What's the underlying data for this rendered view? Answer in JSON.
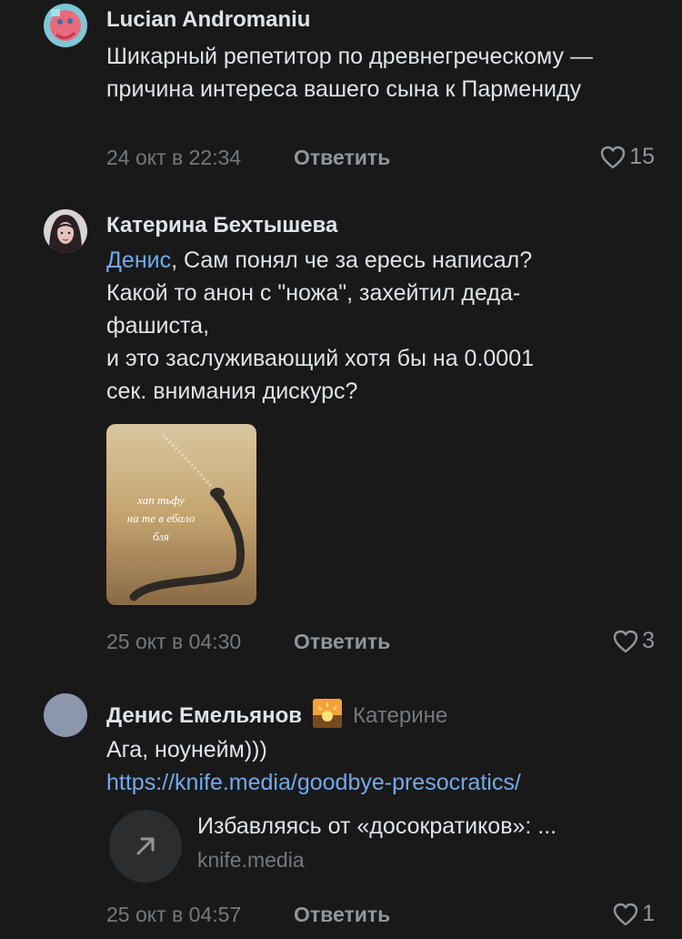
{
  "comments": [
    {
      "author": "Lucian Andromaniu",
      "text": "Шикарный репетитор по древнегреческому — причина  интереса вашего сына к Пармениду",
      "time": "24 окт в 22:34",
      "reply_label": "Ответить",
      "likes": "15"
    },
    {
      "author": "Катерина Бехтышева",
      "mention": "Денис",
      "text_lines": [
        ", Сам понял че за ересь написал?",
        "Какой то анон с \"ножа\", захейтил деда-",
        "фашиста,",
        "и это заслуживающий хотя бы на 0.0001",
        "сек. внимания дискурс?"
      ],
      "photo_caption": [
        "хап тьфу",
        "на те в ебало",
        "бля"
      ],
      "time": "25 окт в 04:30",
      "reply_label": "Ответить",
      "likes": "3"
    },
    {
      "author": "Денис Емельянов",
      "reply_to": "Катерине",
      "text": "Ага, ноунейм)))",
      "link": "https://knife.media/goodbye-presocratics/",
      "card_title": "Избавляясь от «досократиков»: ...",
      "card_domain": "knife.media",
      "time": "25 окт в 04:57",
      "reply_label": "Ответить",
      "likes": "1"
    }
  ],
  "colors": {
    "background": "#19191a",
    "text": "#e1e3e6",
    "secondary": "#76787a",
    "link": "#71aaeb"
  },
  "icons": [
    "heart-outline-icon",
    "arrow-up-right-icon"
  ]
}
